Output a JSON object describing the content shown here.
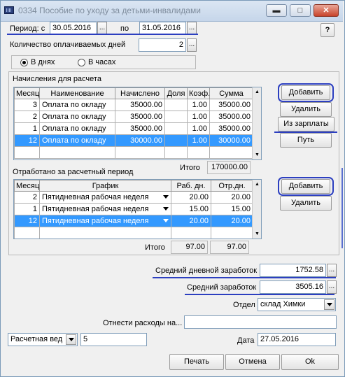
{
  "window": {
    "title": "0334 Пособие по уходу за детьми-инвалидами",
    "help": "?"
  },
  "period": {
    "from_label": "Период: с",
    "from_value": "30.05.2016",
    "to_label": "по",
    "to_value": "31.05.2016",
    "picker": "..."
  },
  "paid_days": {
    "label": "Количество оплачиваемых дней",
    "value": "2",
    "picker": "..."
  },
  "units": {
    "days": "В днях",
    "hours": "В часах",
    "selected": "days"
  },
  "accruals": {
    "title": "Начисления для расчета",
    "columns": [
      "Месяц",
      "Наименование",
      "Начислено",
      "Доля",
      "Коэф.",
      "Сумма"
    ],
    "rows": [
      {
        "month": "3",
        "name": "Оплата по окладу",
        "accrued": "35000.00",
        "share": "",
        "coef": "1.00",
        "sum": "35000.00",
        "selected": false
      },
      {
        "month": "2",
        "name": "Оплата по окладу",
        "accrued": "35000.00",
        "share": "",
        "coef": "1.00",
        "sum": "35000.00",
        "selected": false
      },
      {
        "month": "1",
        "name": "Оплата по окладу",
        "accrued": "35000.00",
        "share": "",
        "coef": "1.00",
        "sum": "35000.00",
        "selected": false
      },
      {
        "month": "12",
        "name": "Оплата по окладу",
        "accrued": "30000.00",
        "share": "",
        "coef": "1.00",
        "sum": "30000.00",
        "selected": true
      }
    ],
    "total_label": "Итого",
    "total_value": "170000.00",
    "buttons": {
      "add": "Добавить",
      "delete": "Удалить",
      "from_salary": "Из зарплаты",
      "path": "Путь"
    }
  },
  "worked": {
    "title": "Отработано за расчетный период",
    "columns": [
      "Месяц",
      "График",
      "Раб. дн.",
      "Отр.дн."
    ],
    "rows": [
      {
        "month": "2",
        "schedule": "Пятидневная рабочая неделя",
        "work_days": "20.00",
        "worked_days": "20.00",
        "selected": false
      },
      {
        "month": "1",
        "schedule": "Пятидневная рабочая неделя",
        "work_days": "15.00",
        "worked_days": "15.00",
        "selected": false
      },
      {
        "month": "12",
        "schedule": "Пятидневная рабочая неделя",
        "work_days": "20.00",
        "worked_days": "20.00",
        "selected": true
      }
    ],
    "total_label": "Итого",
    "total_work_days": "97.00",
    "total_worked_days": "97.00",
    "buttons": {
      "add": "Добавить",
      "delete": "Удалить"
    }
  },
  "avg_daily": {
    "label": "Средний дневной заработок",
    "value": "1752.58",
    "picker": "..."
  },
  "avg_earn": {
    "label": "Средний заработок",
    "value": "3505.16",
    "picker": "..."
  },
  "department": {
    "label": "Отдел",
    "value": "склад Химки"
  },
  "expenses": {
    "label": "Отнести расходы на...",
    "value": ""
  },
  "statement": {
    "type": "Расчетная вед",
    "number": "5"
  },
  "date": {
    "label": "Дата",
    "value": "27.05.2016"
  },
  "footer": {
    "print": "Печать",
    "cancel": "Отмена",
    "ok": "Ok"
  },
  "colors": {
    "accent_oval": "#2c3fc0",
    "selection": "#3399ff"
  }
}
